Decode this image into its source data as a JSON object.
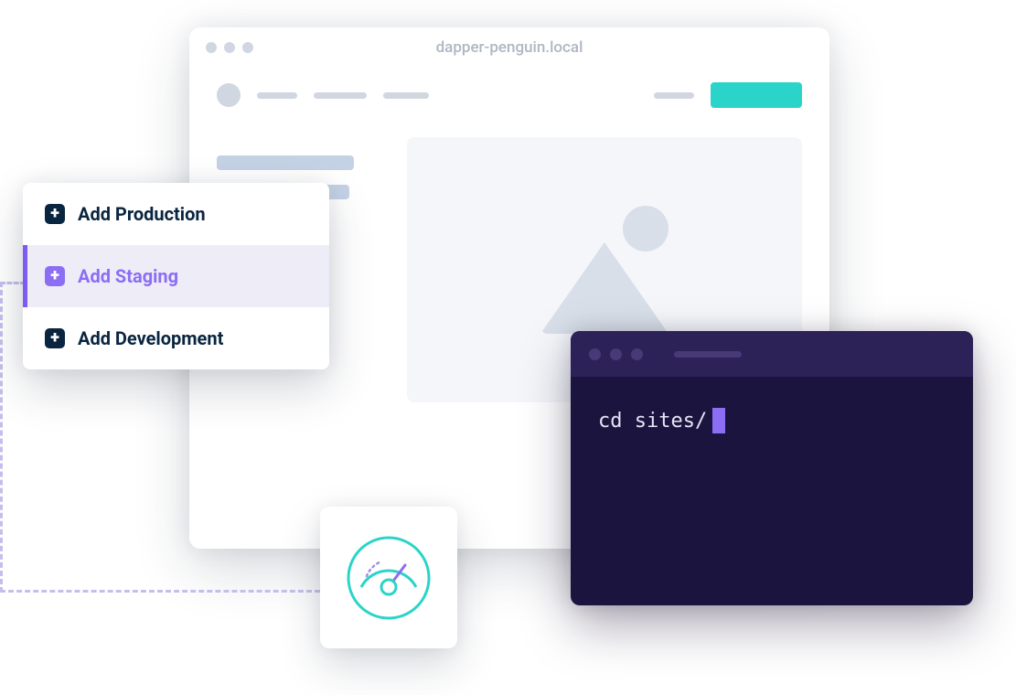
{
  "browser": {
    "url": "dapper-penguin.local"
  },
  "dropdown": {
    "items": [
      {
        "label": "Add Production",
        "active": false
      },
      {
        "label": "Add Staging",
        "active": true
      },
      {
        "label": "Add Development",
        "active": false
      }
    ]
  },
  "terminal": {
    "command": "cd sites/"
  },
  "colors": {
    "accent_teal": "#2bd4c8",
    "accent_purple": "#8b6ef4",
    "terminal_bg": "#1b143e"
  }
}
